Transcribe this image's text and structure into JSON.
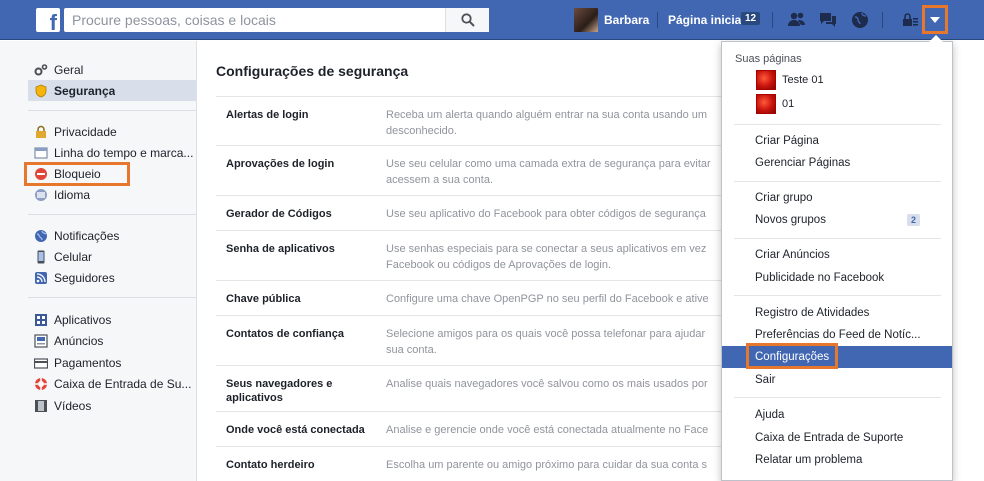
{
  "topbar": {
    "search_placeholder": "Procure pessoas, coisas e locais",
    "user_name": "Barbara",
    "home_label": "Página inicial",
    "home_count": "12"
  },
  "leftnav": {
    "groups": [
      [
        {
          "label": "Geral",
          "icon": "gear-icon"
        },
        {
          "label": "Segurança",
          "icon": "shield-icon",
          "active": true
        }
      ],
      [
        {
          "label": "Privacidade",
          "icon": "lock-icon"
        },
        {
          "label": "Linha do tempo e marca...",
          "icon": "timeline-icon"
        },
        {
          "label": "Bloqueio",
          "icon": "block-icon"
        },
        {
          "label": "Idioma",
          "icon": "globe-icon"
        }
      ],
      [
        {
          "label": "Notificações",
          "icon": "globe-notification-icon"
        },
        {
          "label": "Celular",
          "icon": "mobile-icon"
        },
        {
          "label": "Seguidores",
          "icon": "rss-icon"
        }
      ],
      [
        {
          "label": "Aplicativos",
          "icon": "apps-icon"
        },
        {
          "label": "Anúncios",
          "icon": "ads-icon"
        },
        {
          "label": "Pagamentos",
          "icon": "card-icon"
        },
        {
          "label": "Caixa de Entrada de Su...",
          "icon": "lifebuoy-icon"
        },
        {
          "label": "Vídeos",
          "icon": "film-icon"
        }
      ]
    ]
  },
  "main": {
    "title": "Configurações de segurança",
    "rows": [
      {
        "label": "Alertas de login",
        "desc": "Receba um alerta quando alguém entrar na sua conta usando um desconhecido."
      },
      {
        "label": "Aprovações de login",
        "desc": "Use seu celular como uma camada extra de segurança para evitar acessem a sua conta."
      },
      {
        "label": "Gerador de Códigos",
        "desc": "Use seu aplicativo do Facebook para obter códigos de segurança"
      },
      {
        "label": "Senha de aplicativos",
        "desc": "Use senhas especiais para se conectar a seus aplicativos em vez Facebook ou códigos de Aprovações de login."
      },
      {
        "label": "Chave pública",
        "desc": "Configure uma chave OpenPGP no seu perfil do Facebook e ative"
      },
      {
        "label": "Contatos de confiança",
        "desc": "Selecione amigos para os quais você possa telefonar para ajudar sua conta."
      },
      {
        "label": "Seus navegadores e aplicativos",
        "desc": "Analise quais navegadores você salvou como os mais usados por"
      },
      {
        "label": "Onde você está conectada",
        "desc": "Analise e gerencie onde você está conectada atualmente no Face"
      },
      {
        "label": "Contato herdeiro",
        "desc": "Escolha um parente ou amigo próximo para cuidar da sua conta s"
      }
    ]
  },
  "dropdown": {
    "header": "Suas páginas",
    "pages": [
      "Teste 01",
      "01"
    ],
    "groups": [
      [
        "Criar Página",
        "Gerenciar Páginas"
      ],
      [
        "Criar grupo",
        "Novos grupos"
      ],
      [
        "Criar Anúncios",
        "Publicidade no Facebook"
      ],
      [
        "Registro de Atividades",
        "Preferências do Feed de Notíc...",
        "Configurações",
        "Sair"
      ],
      [
        "Ajuda",
        "Caixa de Entrada de Suporte",
        "Relatar um problema"
      ]
    ],
    "new_groups_badge": "2",
    "selected": "Configurações"
  },
  "colors": {
    "brand": "#4267b2",
    "highlight": "#e8772e"
  }
}
